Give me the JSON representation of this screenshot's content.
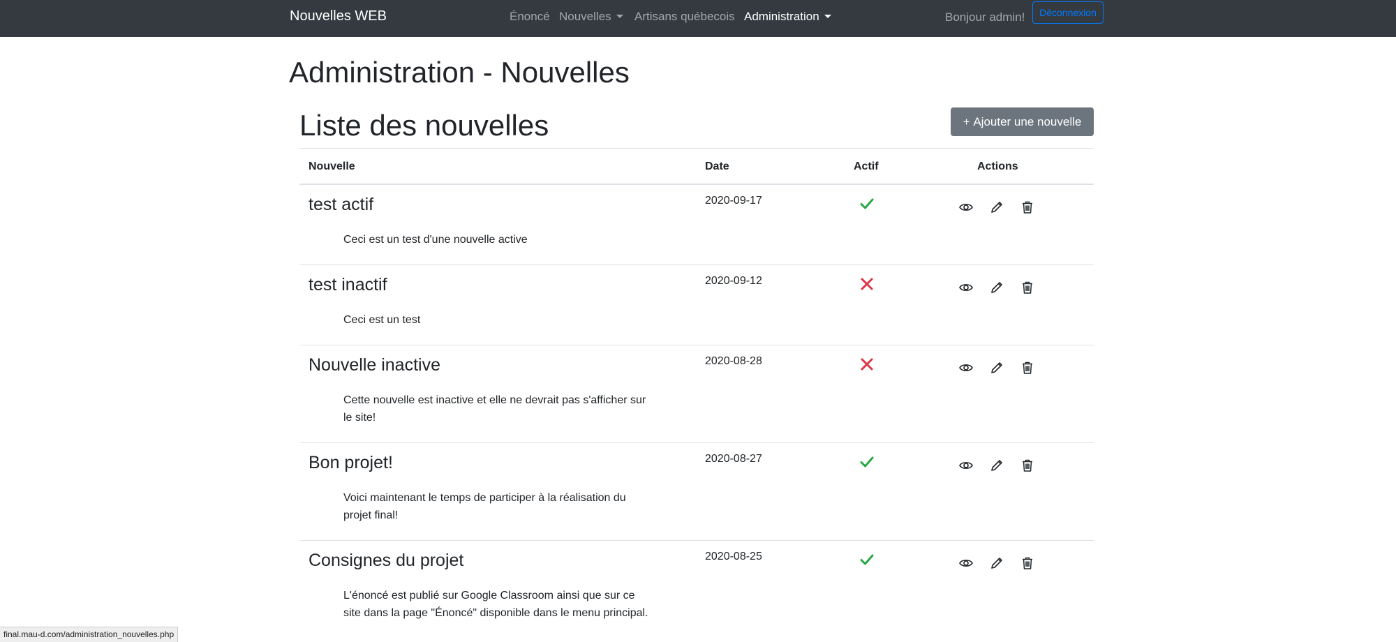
{
  "navbar": {
    "brand": "Nouvelles WEB",
    "links": [
      {
        "label": "Énoncé",
        "dropdown": false,
        "active": false
      },
      {
        "label": "Nouvelles",
        "dropdown": true,
        "active": false
      },
      {
        "label": "Artisans québecois",
        "dropdown": false,
        "active": false
      },
      {
        "label": "Administration",
        "dropdown": true,
        "active": true
      }
    ],
    "greeting": "Bonjour admin!",
    "logout_label": "Déconnexion"
  },
  "page_title": "Administration - Nouvelles",
  "list_title": "Liste des nouvelles",
  "add_button": {
    "icon": "+",
    "label": "Ajouter une nouvelle"
  },
  "table": {
    "columns": {
      "nouvelle": "Nouvelle",
      "date": "Date",
      "actif": "Actif",
      "actions": "Actions"
    },
    "rows": [
      {
        "title": "test actif",
        "description": "Ceci est un test d'une nouvelle active",
        "date": "2020-09-17",
        "active": true
      },
      {
        "title": "test inactif",
        "description": "Ceci est un test",
        "date": "2020-09-12",
        "active": false
      },
      {
        "title": "Nouvelle inactive",
        "description": "Cette nouvelle est inactive et elle ne devrait pas s'afficher sur le site!",
        "date": "2020-08-28",
        "active": false
      },
      {
        "title": "Bon projet!",
        "description": "Voici maintenant le temps de participer à la réalisation du projet final!",
        "date": "2020-08-27",
        "active": true
      },
      {
        "title": "Consignes du projet",
        "description": "L'énoncé est publié sur Google Classroom ainsi que sur ce site dans la page \"Énoncé\" disponible dans le menu principal.",
        "date": "2020-08-25",
        "active": true
      }
    ]
  },
  "status_bar": "final.mau-d.com/administration_nouvelles.php",
  "colors": {
    "navbar_bg": "#343a40",
    "active_check": "#28a745",
    "inactive_x": "#dc3545",
    "outline_primary": "#007bff",
    "secondary_button": "#6c757d"
  },
  "icons": {
    "status_active": "check-icon",
    "status_inactive": "x-icon",
    "actions": [
      "eye-icon",
      "pencil-icon",
      "trash-icon"
    ]
  }
}
